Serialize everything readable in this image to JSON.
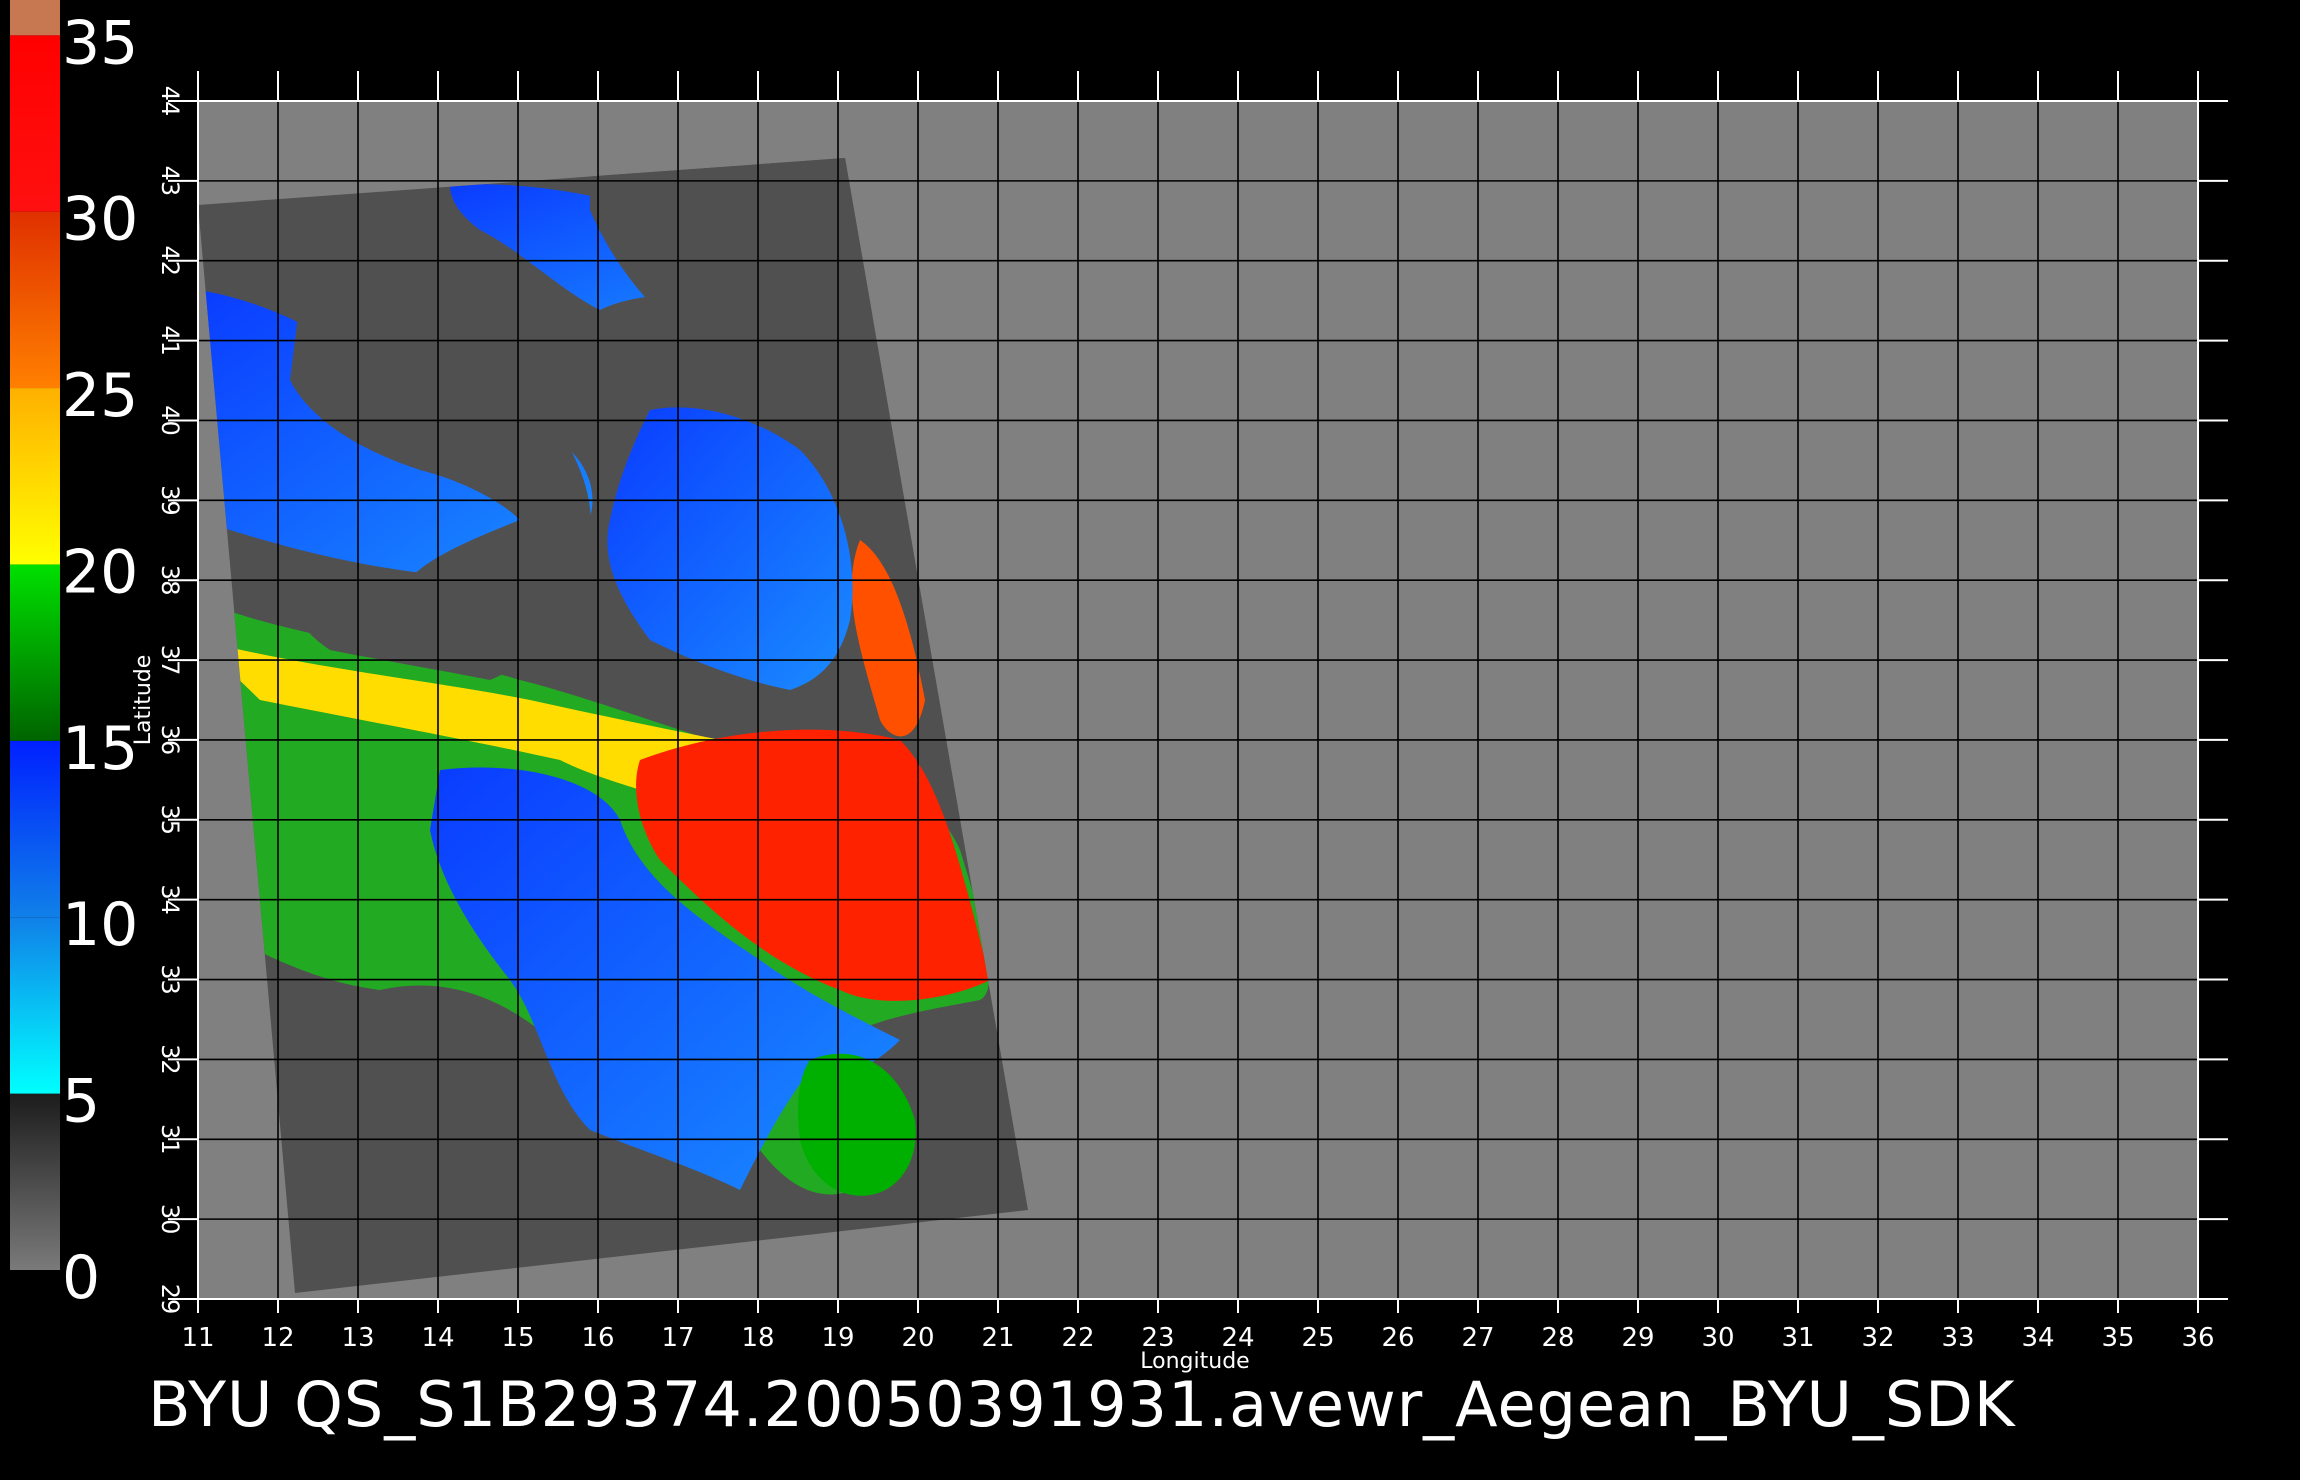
{
  "title": "BYU  QS_S1B29374.20050391931.avewr_Aegean_BYU_SDK",
  "axes": {
    "xlabel": "Longitude",
    "ylabel": "Latitude",
    "lon_ticks": [
      "11",
      "12",
      "13",
      "14",
      "15",
      "16",
      "17",
      "18",
      "19",
      "20",
      "21",
      "22",
      "23",
      "24",
      "25",
      "26",
      "27",
      "28",
      "29",
      "30",
      "31",
      "32",
      "33",
      "34",
      "35",
      "36"
    ],
    "lat_ticks": [
      "29",
      "30",
      "31",
      "32",
      "33",
      "34",
      "35",
      "36",
      "37",
      "38",
      "39",
      "40",
      "41",
      "42",
      "43",
      "44"
    ],
    "lon_range": [
      11,
      36
    ],
    "lat_range": [
      29,
      44
    ]
  },
  "colorbar": {
    "labels": [
      "0",
      "5",
      "10",
      "15",
      "20",
      "25",
      "30",
      "35"
    ],
    "segments": [
      {
        "from": 0,
        "to": 5,
        "colors": [
          "#7a7a7a",
          "#1c1c1c"
        ]
      },
      {
        "from": 5,
        "to": 10,
        "colors": [
          "#00ffff",
          "#1080e8"
        ]
      },
      {
        "from": 10,
        "to": 15,
        "colors": [
          "#1080e8",
          "#0020ff"
        ]
      },
      {
        "from": 15,
        "to": 20,
        "colors": [
          "#006400",
          "#00e000"
        ]
      },
      {
        "from": 20,
        "to": 25,
        "colors": [
          "#ffff00",
          "#ffb000"
        ]
      },
      {
        "from": 25,
        "to": 30,
        "colors": [
          "#ff8000",
          "#e03000"
        ]
      },
      {
        "from": 30,
        "to": 35,
        "colors": [
          "#ff1010",
          "#ff0000"
        ]
      },
      {
        "from": 35,
        "to": 36,
        "colors": [
          "#c87850",
          "#c87850"
        ]
      }
    ]
  },
  "colors": {
    "land_background": "#808080",
    "swath": "#505050",
    "grid": "#000000"
  }
}
